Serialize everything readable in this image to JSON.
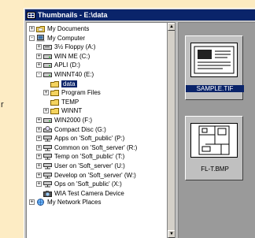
{
  "left_edge": {
    "letter": "r"
  },
  "window": {
    "title": "Thumbnails - E:\\data"
  },
  "tree": [
    {
      "label": "My Documents",
      "toggle": "+",
      "icon": "folder-documents-icon",
      "level": 0,
      "selected": false
    },
    {
      "label": "My Computer",
      "toggle": "-",
      "icon": "computer-icon",
      "level": 0,
      "selected": false
    },
    {
      "label": "3½ Floppy (A:)",
      "toggle": "+",
      "icon": "floppy-drive-icon",
      "level": 1,
      "selected": false
    },
    {
      "label": "WIN ME (C:)",
      "toggle": "+",
      "icon": "hard-drive-icon",
      "level": 1,
      "selected": false
    },
    {
      "label": "APLI (D:)",
      "toggle": "+",
      "icon": "hard-drive-icon",
      "level": 1,
      "selected": false
    },
    {
      "label": "WINNT40 (E:)",
      "toggle": "-",
      "icon": "hard-drive-icon",
      "level": 1,
      "selected": false
    },
    {
      "label": "data",
      "toggle": "",
      "icon": "open-folder-icon",
      "level": 2,
      "selected": true
    },
    {
      "label": "Program Files",
      "toggle": "+",
      "icon": "folder-icon",
      "level": 2,
      "selected": false
    },
    {
      "label": "TEMP",
      "toggle": "",
      "icon": "folder-icon",
      "level": 2,
      "selected": false
    },
    {
      "label": "WINNT",
      "toggle": "+",
      "icon": "folder-icon",
      "level": 2,
      "selected": false
    },
    {
      "label": "WIN2000 (F:)",
      "toggle": "+",
      "icon": "hard-drive-icon",
      "level": 1,
      "selected": false
    },
    {
      "label": "Compact Disc (G:)",
      "toggle": "+",
      "icon": "cd-drive-icon",
      "level": 1,
      "selected": false
    },
    {
      "label": "Apps on 'Soft_public' (P:)",
      "toggle": "+",
      "icon": "network-drive-icon",
      "level": 1,
      "selected": false
    },
    {
      "label": "Common on 'Soft_server' (R:)",
      "toggle": "+",
      "icon": "network-drive-icon",
      "level": 1,
      "selected": false
    },
    {
      "label": "Temp on 'Soft_public' (T:)",
      "toggle": "+",
      "icon": "network-drive-icon",
      "level": 1,
      "selected": false
    },
    {
      "label": "User on 'Soft_server' (U:)",
      "toggle": "+",
      "icon": "network-drive-icon",
      "level": 1,
      "selected": false
    },
    {
      "label": "Develop on 'Soft_server' (W:)",
      "toggle": "+",
      "icon": "network-drive-icon",
      "level": 1,
      "selected": false
    },
    {
      "label": "Ops on 'Soft_public' (X:)",
      "toggle": "+",
      "icon": "network-drive-icon",
      "level": 1,
      "selected": false
    },
    {
      "label": "WIA Test Camera Device",
      "toggle": "",
      "icon": "camera-icon",
      "level": 1,
      "selected": false
    },
    {
      "label": "My Network Places",
      "toggle": "+",
      "icon": "network-places-icon",
      "level": 0,
      "selected": false
    }
  ],
  "thumbnails": [
    {
      "caption": "SAMPLE.TIF",
      "selected": true,
      "icon": "tif-thumbnail"
    },
    {
      "caption": "FL-T.BMP",
      "selected": false,
      "icon": "bmp-floorplan-thumbnail"
    }
  ],
  "colors": {
    "selection": "#0a246a",
    "background": "#fcebc0",
    "window": "#c0c0c0"
  }
}
